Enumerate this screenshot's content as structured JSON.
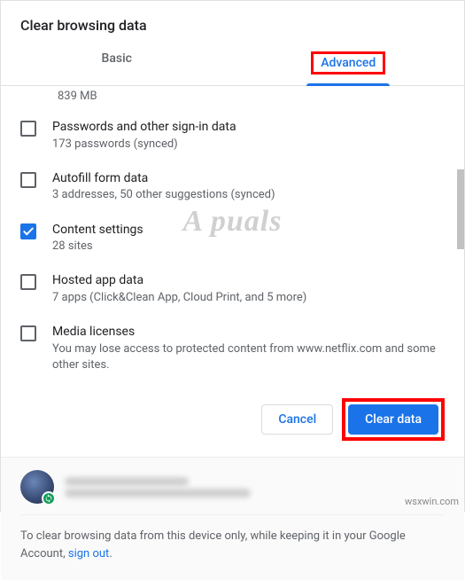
{
  "header": {
    "title": "Clear browsing data"
  },
  "tabs": {
    "basic": "Basic",
    "advanced": "Advanced"
  },
  "truncated_top": "839 MB",
  "options": [
    {
      "title": "Passwords and other sign-in data",
      "sub": "173 passwords (synced)",
      "checked": false
    },
    {
      "title": "Autofill form data",
      "sub": "3 addresses, 50 other suggestions (synced)",
      "checked": false
    },
    {
      "title": "Content settings",
      "sub": "28 sites",
      "checked": true
    },
    {
      "title": "Hosted app data",
      "sub": "7 apps (Click&Clean App, Cloud Print, and 5 more)",
      "checked": false
    },
    {
      "title": "Media licenses",
      "sub": "You may lose access to protected content from www.netflix.com and some other sites.",
      "checked": false
    }
  ],
  "buttons": {
    "cancel": "Cancel",
    "clear": "Clear data"
  },
  "footer": {
    "note_before": "To clear browsing data from this device only, while keeping it in your Google Account, ",
    "signout": "sign out",
    "note_after": "."
  },
  "watermark": "A  puals",
  "source_mark": "wsxwin.com"
}
